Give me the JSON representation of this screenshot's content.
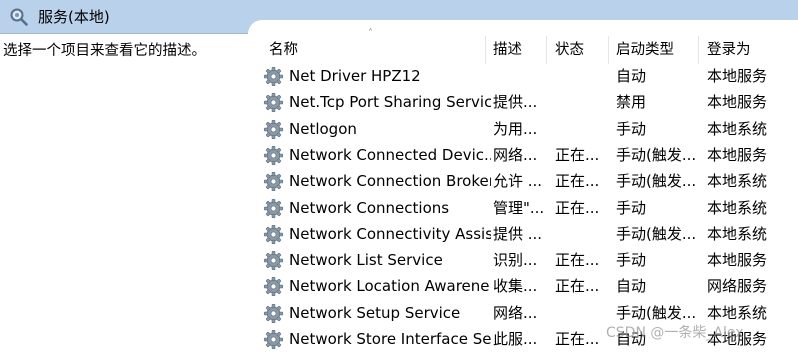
{
  "window": {
    "title": "服务(本地)",
    "icon": "services-gear-magnifier-icon"
  },
  "description_pane": {
    "text": "选择一个项目来查看它的描述。"
  },
  "columns": {
    "name": "名称",
    "description": "描述",
    "status": "状态",
    "startup_type": "启动类型",
    "logon_as": "登录为"
  },
  "sort_indicator": "˄",
  "services": [
    {
      "name": "Net Driver HPZ12",
      "description": "",
      "status": "",
      "startup_type": "自动",
      "logon_as": "本地服务"
    },
    {
      "name": "Net.Tcp Port Sharing Service",
      "description": "提供...",
      "status": "",
      "startup_type": "禁用",
      "logon_as": "本地服务"
    },
    {
      "name": "Netlogon",
      "description": "为用...",
      "status": "",
      "startup_type": "手动",
      "logon_as": "本地系统"
    },
    {
      "name": "Network Connected Devic...",
      "description": "网络...",
      "status": "正在...",
      "startup_type": "手动(触发...",
      "logon_as": "本地服务"
    },
    {
      "name": "Network Connection Broker",
      "description": "允许 ...",
      "status": "正在...",
      "startup_type": "手动(触发...",
      "logon_as": "本地系统"
    },
    {
      "name": "Network Connections",
      "description": "管理\"...",
      "status": "正在...",
      "startup_type": "手动",
      "logon_as": "本地系统"
    },
    {
      "name": "Network Connectivity Assis...",
      "description": "提供 ...",
      "status": "",
      "startup_type": "手动(触发...",
      "logon_as": "本地系统"
    },
    {
      "name": "Network List Service",
      "description": "识别...",
      "status": "正在...",
      "startup_type": "手动",
      "logon_as": "本地服务"
    },
    {
      "name": "Network Location Awarene...",
      "description": "收集...",
      "status": "正在...",
      "startup_type": "自动",
      "logon_as": "网络服务"
    },
    {
      "name": "Network Setup Service",
      "description": "网络...",
      "status": "",
      "startup_type": "手动(触发...",
      "logon_as": "本地系统"
    },
    {
      "name": "Network Store Interface Se...",
      "description": "此服...",
      "status": "正在...",
      "startup_type": "自动",
      "logon_as": "本地服务"
    }
  ],
  "watermark": "CSDN @一条柴_Alex",
  "colors": {
    "titlebar": "#b9d1ea",
    "background": "#ffffff",
    "gear": "#8a9aa8"
  }
}
